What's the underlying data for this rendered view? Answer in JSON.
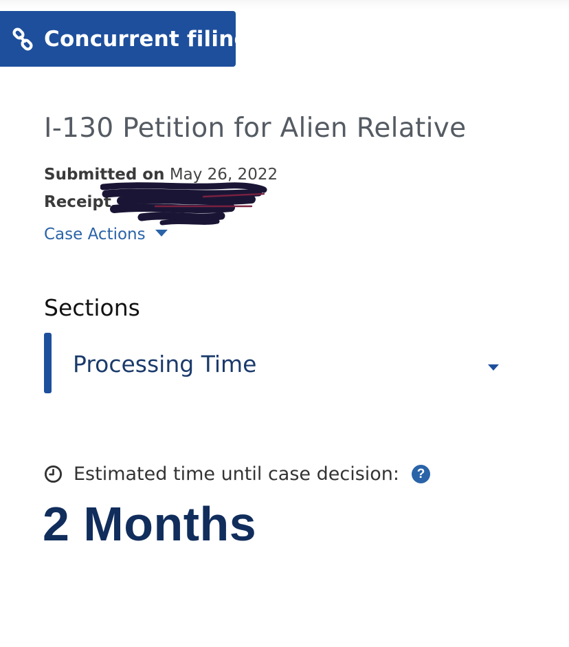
{
  "badge": {
    "icon": "link-icon",
    "label": "Concurrent filing",
    "color": "#1e4f9c"
  },
  "case": {
    "form_title": "I-130 Petition for Alien Relative",
    "submitted_label": "Submitted on",
    "submitted_date": "May 26, 2022",
    "receipt_label": "Receipt #",
    "case_actions_label": "Case Actions"
  },
  "sections": {
    "title": "Sections",
    "selected": "Processing Time"
  },
  "processing": {
    "estimate_label": "Estimated time until case decision:",
    "estimate_value": "2 Months",
    "help_glyph": "?",
    "clock_icon": "clock-icon",
    "help_icon": "question-circle-icon",
    "value_color": "#102d5c",
    "link_color": "#2a63a8"
  }
}
